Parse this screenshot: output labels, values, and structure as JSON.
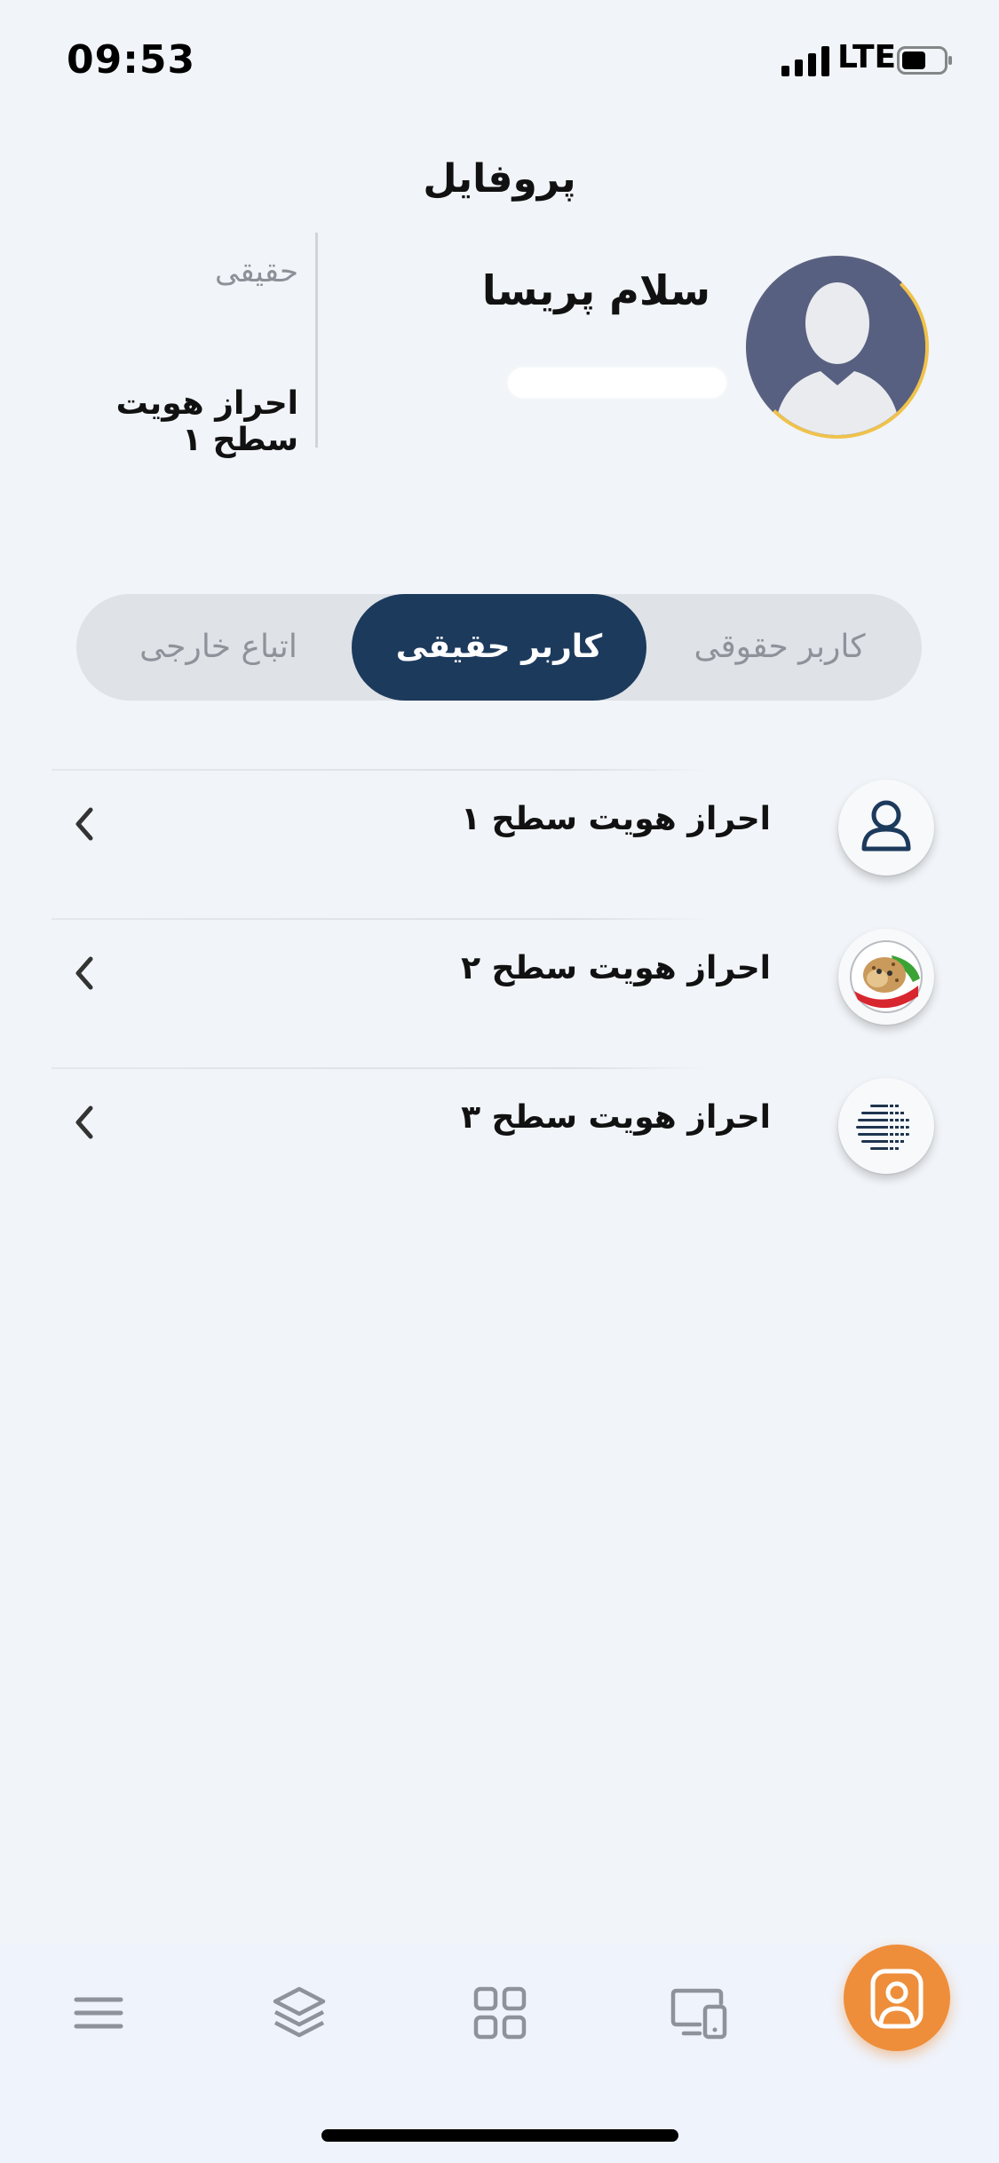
{
  "status_bar": {
    "time": "09:53",
    "network": "LTE",
    "battery_level": 0.5
  },
  "header": {
    "title": "پروفایل"
  },
  "profile": {
    "greeting": "سلام پریسا",
    "user_type": "حقیقی",
    "verification_level": "احراز هویت سطح ۱"
  },
  "segmented": {
    "options": [
      {
        "label": "کاربر حقوقی",
        "selected": false
      },
      {
        "label": "کاربر حقیقی",
        "selected": true
      },
      {
        "label": "اتباع خارجی",
        "selected": false
      }
    ]
  },
  "verification_list": {
    "items": [
      {
        "label": "احراز هویت سطح ۱",
        "icon": "user-outline-icon"
      },
      {
        "label": "احراز هویت سطح ۲",
        "icon": "cheetah-flag-icon"
      },
      {
        "label": "احراز هویت سطح ۳",
        "icon": "globe-dots-icon"
      }
    ]
  },
  "bottom_nav": {
    "items": [
      {
        "icon": "menu-icon",
        "active": false
      },
      {
        "icon": "layers-icon",
        "active": false
      },
      {
        "icon": "grid-icon",
        "active": false
      },
      {
        "icon": "devices-icon",
        "active": false
      },
      {
        "icon": "profile-icon",
        "active": true
      }
    ]
  },
  "colors": {
    "accent": "#1c3a5c",
    "nav_active": "#ee8e3a",
    "background": "#f1f4f8"
  }
}
